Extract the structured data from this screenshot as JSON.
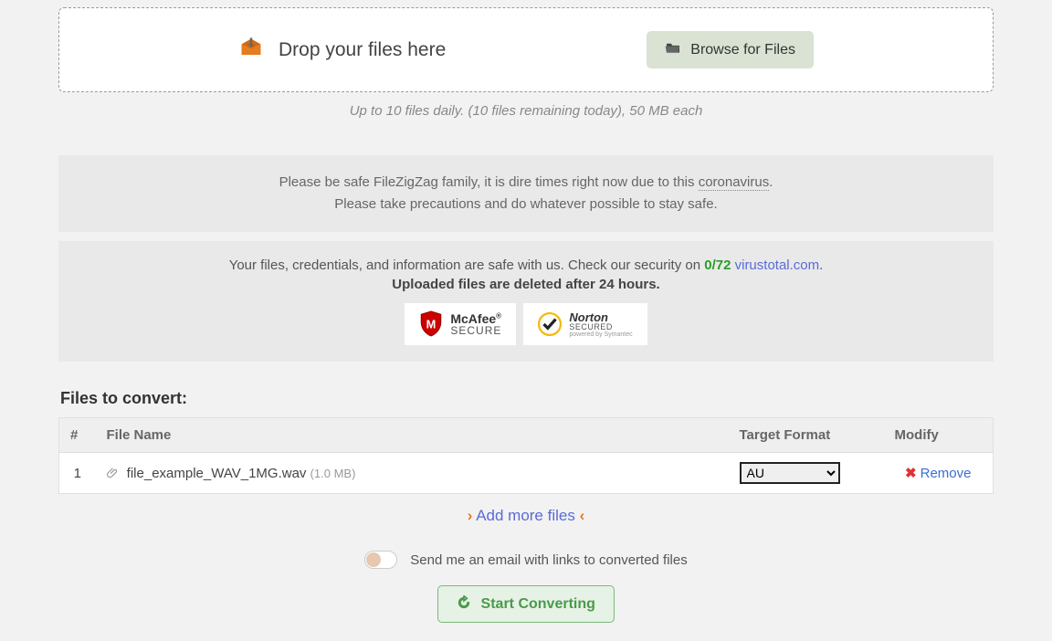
{
  "dropzone": {
    "drop_text": "Drop your files here",
    "browse_label": "Browse for Files"
  },
  "limits_text": "Up to 10 files daily. (10 files remaining today), 50 MB each",
  "safety_notice": {
    "line1_pre": "Please be safe FileZigZag family, it is dire times right now due to this ",
    "link_word": "coronavirus",
    "line1_post": ".",
    "line2": "Please take precautions and do whatever possible to stay safe."
  },
  "security": {
    "pre": "Your files, credentials, and information are safe with us. Check our security on ",
    "score": "0/72",
    "vt_label": "virustotal.com",
    "post": ".",
    "delete_line": "Uploaded files are deleted after 24 hours.",
    "badge1_top": "McAfee",
    "badge1_bottom": "SECURE",
    "badge2_top": "Norton",
    "badge2_bottom": "SECURED",
    "badge2_sub": "powered by Symantec"
  },
  "files_section": {
    "title": "Files to convert:",
    "headers": {
      "num": "#",
      "name": "File Name",
      "target": "Target Format",
      "modify": "Modify"
    },
    "rows": [
      {
        "num": "1",
        "name": "file_example_WAV_1MG.wav",
        "size": "(1.0 MB)",
        "format": "AU",
        "remove": "Remove"
      }
    ],
    "add_more": "Add more files"
  },
  "email_toggle_label": "Send me an email with links to converted files",
  "start_label": "Start Converting"
}
